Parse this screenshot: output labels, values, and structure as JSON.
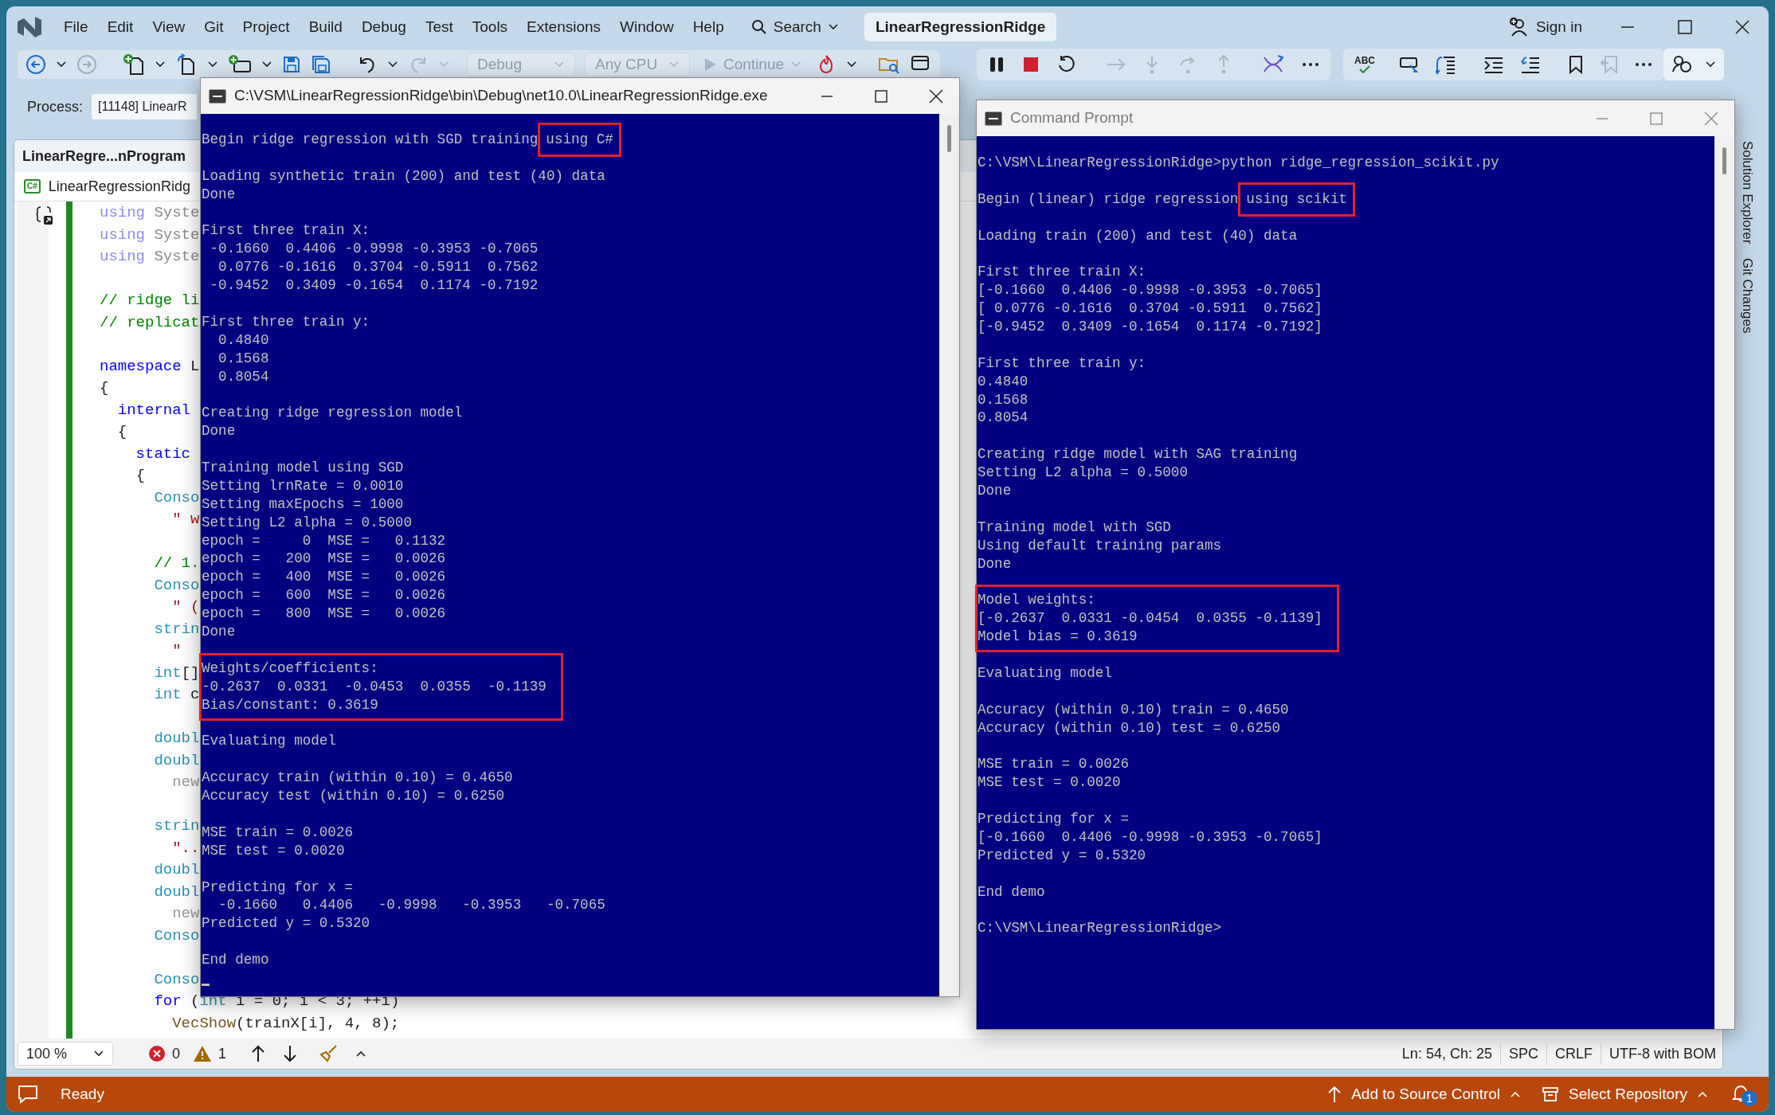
{
  "menu_bar": {
    "items": [
      "File",
      "Edit",
      "View",
      "Git",
      "Project",
      "Build",
      "Debug",
      "Test",
      "Tools",
      "Extensions",
      "Window",
      "Help"
    ],
    "search": "Search",
    "solution_title": "LinearRegressionRidge",
    "sign_in": "Sign in"
  },
  "toolbar": {
    "configuration": {
      "label": "Debug",
      "disabled": true
    },
    "platform": {
      "label": "Any CPU",
      "disabled": true
    },
    "continue": {
      "label": "Continue",
      "disabled": true
    },
    "spell_check": "ABC"
  },
  "process_bar": {
    "label": "Process:",
    "value": "[11148] LinearR"
  },
  "editor": {
    "tab": "LinearRegre...nProgram",
    "file_icon": "C#",
    "file_path": "LinearRegressionRidg",
    "lines": [
      {
        "parts": [
          {
            "kind": "dim_keyword",
            "text": "using"
          },
          {
            "kind": "dim",
            "text": " Syste"
          }
        ]
      },
      {
        "parts": [
          {
            "kind": "dim_keyword",
            "text": "using"
          },
          {
            "kind": "dim",
            "text": " Syste"
          }
        ]
      },
      {
        "parts": [
          {
            "kind": "dim_keyword",
            "text": "using"
          },
          {
            "kind": "dim",
            "text": " Syste"
          }
        ]
      },
      {
        "kind": "blank"
      },
      {
        "parts": [
          {
            "kind": "comment",
            "text": "// ridge li"
          }
        ]
      },
      {
        "parts": [
          {
            "kind": "comment",
            "text": "// replicat"
          }
        ]
      },
      {
        "kind": "blank"
      },
      {
        "parts": [
          {
            "kind": "keyword",
            "text": "namespace"
          },
          {
            "kind": "plain",
            "text": " L"
          }
        ]
      },
      {
        "parts": [
          {
            "kind": "plain",
            "text": "{"
          }
        ]
      },
      {
        "parts": [
          {
            "kind": "keyword",
            "text": "  internal"
          }
        ]
      },
      {
        "parts": [
          {
            "kind": "plain",
            "text": "  {"
          }
        ]
      },
      {
        "parts": [
          {
            "kind": "keyword",
            "text": "    static"
          }
        ]
      },
      {
        "parts": [
          {
            "kind": "plain",
            "text": "    {"
          }
        ]
      },
      {
        "parts": [
          {
            "kind": "type",
            "text": "      Conso"
          }
        ]
      },
      {
        "parts": [
          {
            "kind": "string",
            "text": "        \" w"
          }
        ]
      },
      {
        "kind": "blank"
      },
      {
        "parts": [
          {
            "kind": "comment",
            "text": "      // 1."
          }
        ]
      },
      {
        "parts": [
          {
            "kind": "type",
            "text": "      Conso"
          }
        ]
      },
      {
        "parts": [
          {
            "kind": "string",
            "text": "        \" ("
          }
        ]
      },
      {
        "parts": [
          {
            "kind": "type",
            "text": "      strin"
          }
        ]
      },
      {
        "parts": [
          {
            "kind": "string",
            "text": "        \""
          }
        ]
      },
      {
        "parts": [
          {
            "kind": "type",
            "text": "      int"
          },
          {
            "kind": "plain",
            "text": "[]"
          }
        ]
      },
      {
        "parts": [
          {
            "kind": "type",
            "text": "      int"
          },
          {
            "kind": "plain",
            "text": " c"
          }
        ]
      },
      {
        "kind": "blank"
      },
      {
        "parts": [
          {
            "kind": "type",
            "text": "      doubl"
          }
        ]
      },
      {
        "parts": [
          {
            "kind": "type",
            "text": "      doubl"
          }
        ]
      },
      {
        "parts": [
          {
            "kind": "hint",
            "text": "        new"
          }
        ]
      },
      {
        "kind": "blank"
      },
      {
        "parts": [
          {
            "kind": "type",
            "text": "      strin"
          }
        ]
      },
      {
        "parts": [
          {
            "kind": "string",
            "text": "        \".."
          }
        ]
      },
      {
        "parts": [
          {
            "kind": "type",
            "text": "      doubl"
          }
        ]
      },
      {
        "parts": [
          {
            "kind": "type",
            "text": "      doubl"
          }
        ]
      },
      {
        "parts": [
          {
            "kind": "hint",
            "text": "        new"
          }
        ]
      },
      {
        "parts": [
          {
            "kind": "type",
            "text": "      Conso"
          }
        ]
      },
      {
        "kind": "blank"
      },
      {
        "parts": [
          {
            "kind": "type",
            "text": "      Conso"
          }
        ]
      },
      {
        "parts": [
          {
            "kind": "keyword",
            "text": "      for"
          },
          {
            "kind": "plain",
            "text": " ("
          },
          {
            "kind": "type",
            "text": "int"
          },
          {
            "kind": "plain",
            "text": " i = 0; i < 3; ++i)"
          }
        ]
      },
      {
        "parts": [
          {
            "kind": "method",
            "text": "        VecShow"
          },
          {
            "kind": "plain",
            "text": "(trainX[i], 4, 8);"
          }
        ]
      }
    ],
    "zoom": "100 %",
    "errors": "0",
    "warnings": "1",
    "position": "Ln: 54, Ch: 25",
    "indentation": "SPC",
    "line_ending": "CRLF",
    "encoding": "UTF-8 with BOM"
  },
  "side_tabs": [
    "Solution Explorer",
    "Git Changes"
  ],
  "status_bar": {
    "text": "Ready",
    "source_control": "Add to Source Control",
    "repository": "Select Repository",
    "notifications": "1"
  },
  "consoles": [
    {
      "title": "C:\\VSM\\LinearRegressionRidge\\bin\\Debug\\net10.0\\LinearRegressionRidge.exe",
      "active": true,
      "cursor": true,
      "lines": [
        {
          "kind": "text",
          "text": "Begin ridge regression with SGD training",
          "boxed": "using C#"
        },
        {
          "kind": "blank"
        },
        {
          "kind": "text",
          "text": "Loading synthetic train (200) and test (40) data"
        },
        {
          "kind": "text",
          "text": "Done"
        },
        {
          "kind": "blank"
        },
        {
          "kind": "text",
          "text": "First three train X:"
        },
        {
          "kind": "text",
          "text": " -0.1660  0.4406 -0.9998 -0.3953 -0.7065"
        },
        {
          "kind": "text",
          "text": "  0.0776 -0.1616  0.3704 -0.5911  0.7562"
        },
        {
          "kind": "text",
          "text": " -0.9452  0.3409 -0.1654  0.1174 -0.7192"
        },
        {
          "kind": "blank"
        },
        {
          "kind": "text",
          "text": "First three train y:"
        },
        {
          "kind": "text",
          "text": "  0.4840"
        },
        {
          "kind": "text",
          "text": "  0.1568"
        },
        {
          "kind": "text",
          "text": "  0.8054"
        },
        {
          "kind": "blank"
        },
        {
          "kind": "text",
          "text": "Creating ridge regression model"
        },
        {
          "kind": "text",
          "text": "Done"
        },
        {
          "kind": "blank"
        },
        {
          "kind": "text",
          "text": "Training model using SGD"
        },
        {
          "kind": "text",
          "text": "Setting lrnRate = 0.0010"
        },
        {
          "kind": "text",
          "text": "Setting maxEpochs = 1000"
        },
        {
          "kind": "text",
          "text": "Setting L2 alpha = 0.5000"
        },
        {
          "kind": "text",
          "text": "epoch =     0  MSE =   0.1132"
        },
        {
          "kind": "text",
          "text": "epoch =   200  MSE =   0.0026"
        },
        {
          "kind": "text",
          "text": "epoch =   400  MSE =   0.0026"
        },
        {
          "kind": "text",
          "text": "epoch =   600  MSE =   0.0026"
        },
        {
          "kind": "text",
          "text": "epoch =   800  MSE =   0.0026"
        },
        {
          "kind": "text",
          "text": "Done"
        },
        {
          "kind": "blank"
        },
        {
          "kind": "boxed",
          "lines": [
            "Weights/coefficients:",
            "-0.2637  0.0331  -0.0453  0.0355  -0.1139",
            "Bias/constant: 0.3619"
          ]
        },
        {
          "kind": "blank"
        },
        {
          "kind": "text",
          "text": "Evaluating model"
        },
        {
          "kind": "blank"
        },
        {
          "kind": "text",
          "text": "Accuracy train (within 0.10) = 0.4650"
        },
        {
          "kind": "text",
          "text": "Accuracy test (within 0.10) = 0.6250"
        },
        {
          "kind": "blank"
        },
        {
          "kind": "text",
          "text": "MSE train = 0.0026"
        },
        {
          "kind": "text",
          "text": "MSE test = 0.0020"
        },
        {
          "kind": "blank"
        },
        {
          "kind": "text",
          "text": "Predicting for x ="
        },
        {
          "kind": "text",
          "text": "  -0.1660   0.4406   -0.9998   -0.3953   -0.7065"
        },
        {
          "kind": "text",
          "text": "Predicted y = 0.5320"
        },
        {
          "kind": "blank"
        },
        {
          "kind": "text",
          "text": "End demo"
        }
      ]
    },
    {
      "title": "Command Prompt",
      "active": false,
      "cursor": false,
      "lines": [
        {
          "kind": "text",
          "text": "C:\\VSM\\LinearRegressionRidge>python ridge_regression_scikit.py"
        },
        {
          "kind": "blank"
        },
        {
          "kind": "text",
          "text": "Begin (linear) ridge regression",
          "boxed": "using scikit"
        },
        {
          "kind": "blank"
        },
        {
          "kind": "text",
          "text": "Loading train (200) and test (40) data"
        },
        {
          "kind": "blank"
        },
        {
          "kind": "text",
          "text": "First three train X:"
        },
        {
          "kind": "text",
          "text": "[-0.1660  0.4406 -0.9998 -0.3953 -0.7065]"
        },
        {
          "kind": "text",
          "text": "[ 0.0776 -0.1616  0.3704 -0.5911  0.7562]"
        },
        {
          "kind": "text",
          "text": "[-0.9452  0.3409 -0.1654  0.1174 -0.7192]"
        },
        {
          "kind": "blank"
        },
        {
          "kind": "text",
          "text": "First three train y:"
        },
        {
          "kind": "text",
          "text": "0.4840"
        },
        {
          "kind": "text",
          "text": "0.1568"
        },
        {
          "kind": "text",
          "text": "0.8054"
        },
        {
          "kind": "blank"
        },
        {
          "kind": "text",
          "text": "Creating ridge model with SAG training"
        },
        {
          "kind": "text",
          "text": "Setting L2 alpha = 0.5000"
        },
        {
          "kind": "text",
          "text": "Done"
        },
        {
          "kind": "blank"
        },
        {
          "kind": "text",
          "text": "Training model with SGD"
        },
        {
          "kind": "text",
          "text": "Using default training params"
        },
        {
          "kind": "text",
          "text": "Done"
        },
        {
          "kind": "blank"
        },
        {
          "kind": "boxed",
          "lines": [
            "Model weights:",
            "[-0.2637  0.0331 -0.0454  0.0355 -0.1139]",
            "Model bias = 0.3619"
          ]
        },
        {
          "kind": "blank"
        },
        {
          "kind": "text",
          "text": "Evaluating model"
        },
        {
          "kind": "blank"
        },
        {
          "kind": "text",
          "text": "Accuracy (within 0.10) train = 0.4650"
        },
        {
          "kind": "text",
          "text": "Accuracy (within 0.10) test = 0.6250"
        },
        {
          "kind": "blank"
        },
        {
          "kind": "text",
          "text": "MSE train = 0.0026"
        },
        {
          "kind": "text",
          "text": "MSE test = 0.0020"
        },
        {
          "kind": "blank"
        },
        {
          "kind": "text",
          "text": "Predicting for x ="
        },
        {
          "kind": "text",
          "text": "[-0.1660  0.4406 -0.9998 -0.3953 -0.7065]"
        },
        {
          "kind": "text",
          "text": "Predicted y = 0.5320"
        },
        {
          "kind": "blank"
        },
        {
          "kind": "text",
          "text": "End demo"
        },
        {
          "kind": "blank"
        },
        {
          "kind": "text",
          "text": "C:\\VSM\\LinearRegressionRidge>"
        }
      ]
    }
  ]
}
